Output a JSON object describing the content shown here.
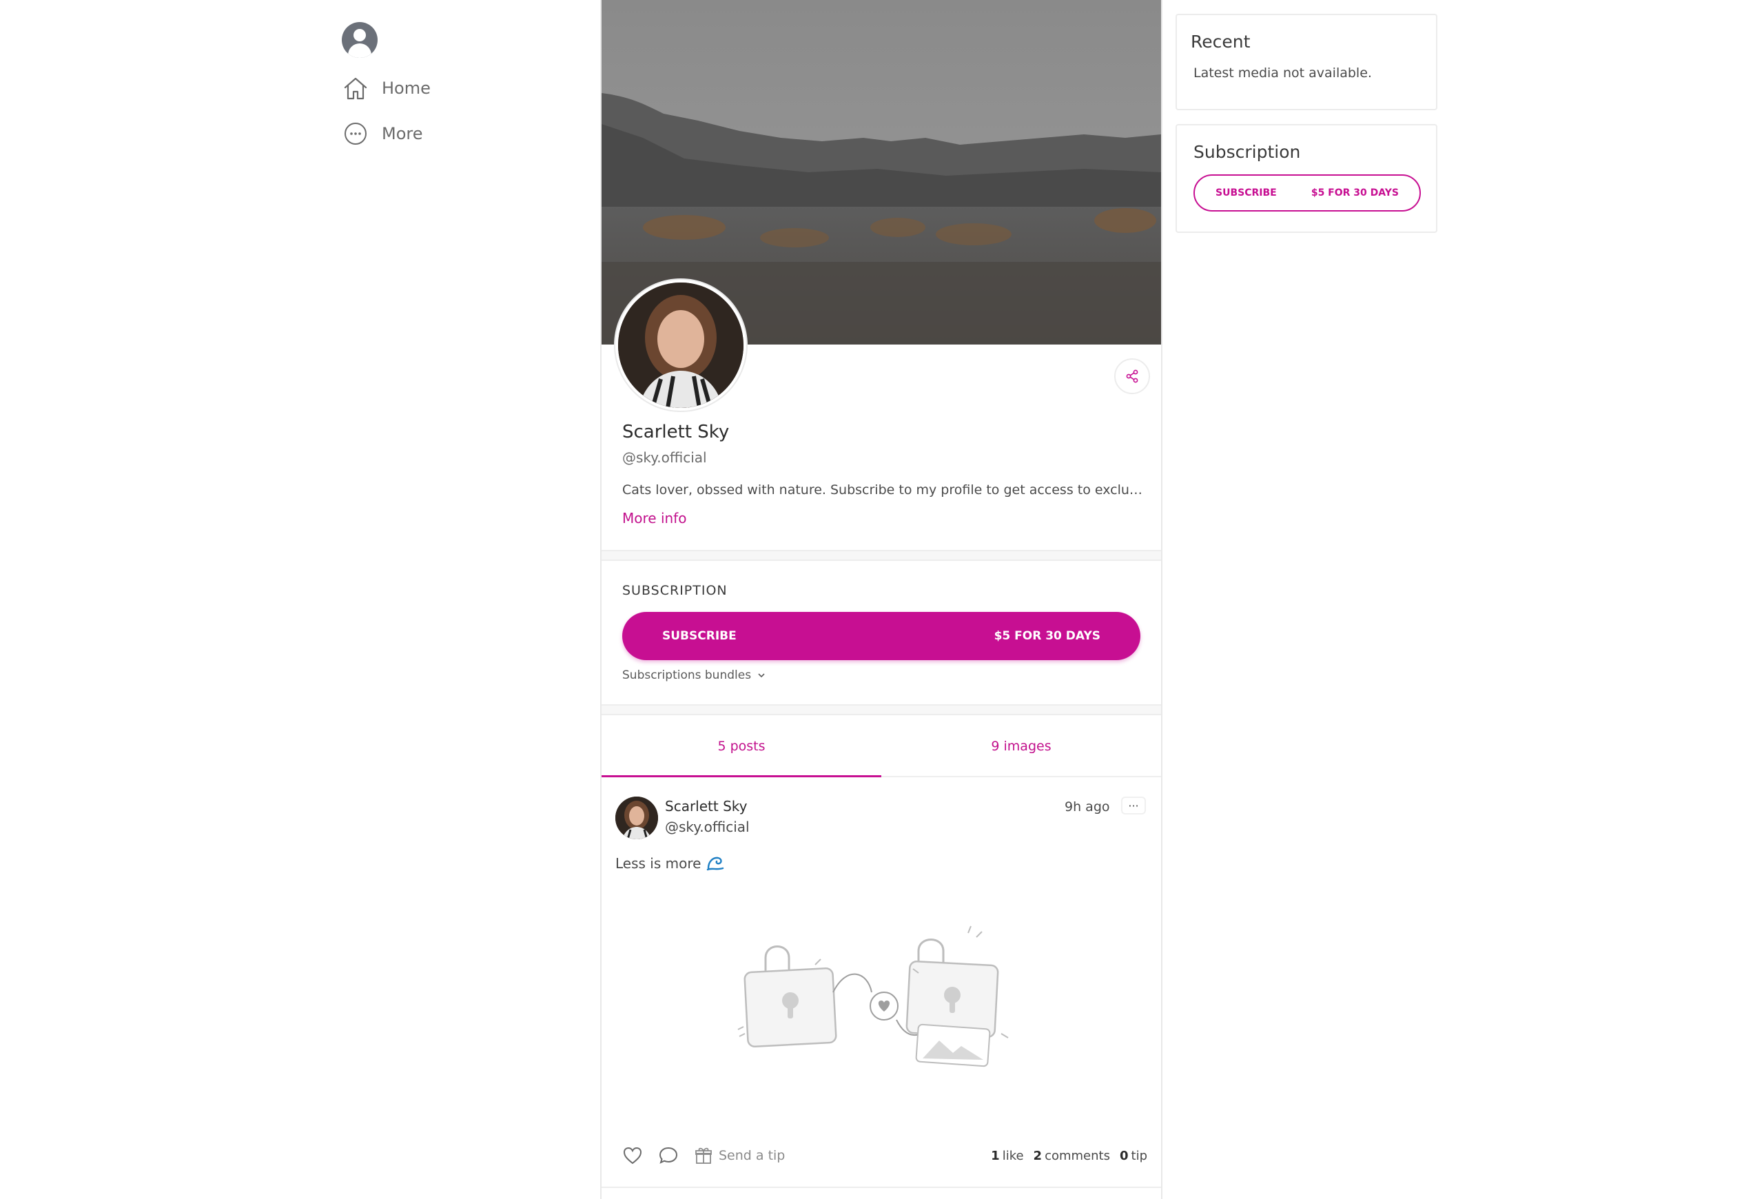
{
  "nav": {
    "items": [
      {
        "label": "Home",
        "icon": "home-icon"
      },
      {
        "label": "More",
        "icon": "more-circle-icon"
      }
    ]
  },
  "profile": {
    "name": "Scarlett Sky",
    "handle": "@sky.official",
    "bio": "Cats lover, obssed with nature. Subscribe to my profile to get access to exclusiv...",
    "more_info_label": "More info"
  },
  "subscription": {
    "title": "SUBSCRIPTION",
    "subscribe_label": "SUBSCRIBE",
    "price_label": "$5 FOR 30 DAYS",
    "bundles_label": "Subscriptions bundles"
  },
  "tabs": [
    {
      "label": "5 posts",
      "active": true
    },
    {
      "label": "9 images",
      "active": false
    }
  ],
  "post": {
    "author_name": "Scarlett Sky",
    "author_handle": "@sky.official",
    "time": "9h ago",
    "menu_label": "···",
    "text": "Less is more",
    "send_tip_label": "Send a tip",
    "likes_count": "1",
    "likes_label": "like",
    "comments_count": "2",
    "comments_label": "comments",
    "tips_count": "0",
    "tips_label": "tip"
  },
  "sidebar": {
    "recent_title": "Recent",
    "recent_message": "Latest media not available.",
    "subscription_title": "Subscription",
    "subscribe_label": "SUBSCRIBE",
    "price_label": "$5 FOR 30 DAYS"
  },
  "colors": {
    "accent": "#c70f92",
    "text": "#2e2e2e",
    "muted": "#6b6b6b"
  }
}
